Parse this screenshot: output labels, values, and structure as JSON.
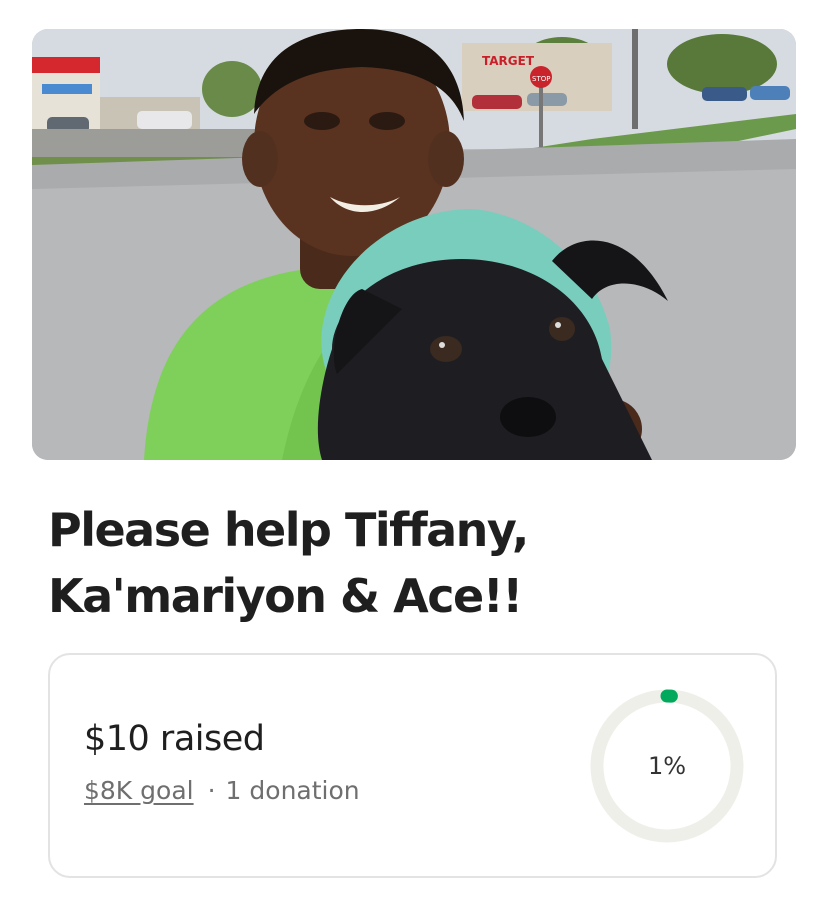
{
  "hero": {
    "store_sign": "TARGET",
    "stop_sign": "STOP"
  },
  "campaign": {
    "title_line1": "Please help Tiffany,",
    "title_line2": "Ka'mariyon & Ace!!"
  },
  "progress": {
    "raised_text": "$10 raised",
    "goal_text": "$8K goal",
    "separator": "·",
    "donations_text": "1 donation",
    "percent_text": "1%",
    "percent_value": 1,
    "colors": {
      "ring_track": "#efefea",
      "ring_progress": "#02a95c"
    }
  }
}
